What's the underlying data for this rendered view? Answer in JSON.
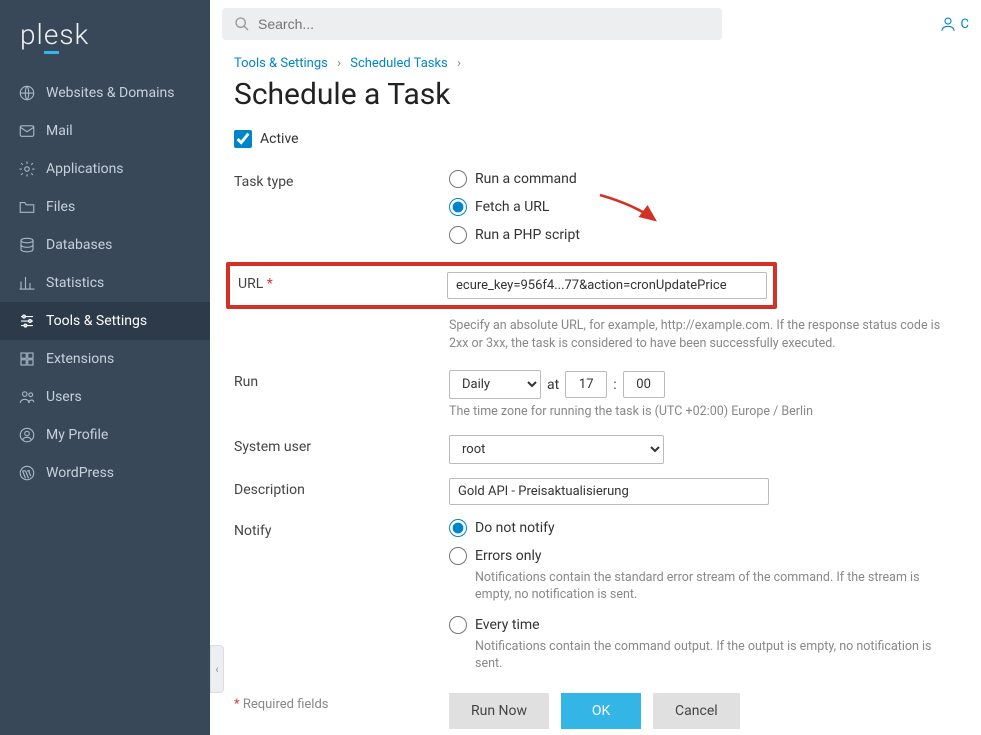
{
  "brand": "plesk",
  "sidebar": {
    "items": [
      {
        "label": "Websites & Domains",
        "icon": "globe"
      },
      {
        "label": "Mail",
        "icon": "mail"
      },
      {
        "label": "Applications",
        "icon": "gear"
      },
      {
        "label": "Files",
        "icon": "folder"
      },
      {
        "label": "Databases",
        "icon": "database"
      },
      {
        "label": "Statistics",
        "icon": "stats"
      },
      {
        "label": "Tools & Settings",
        "icon": "sliders"
      },
      {
        "label": "Extensions",
        "icon": "puzzle"
      },
      {
        "label": "Users",
        "icon": "users"
      },
      {
        "label": "My Profile",
        "icon": "profile"
      },
      {
        "label": "WordPress",
        "icon": "wordpress"
      }
    ],
    "activeIndex": 6
  },
  "search": {
    "placeholder": "Search..."
  },
  "userlink": "C",
  "breadcrumb": {
    "items": [
      "Tools & Settings",
      "Scheduled Tasks"
    ]
  },
  "page_title": "Schedule a Task",
  "form": {
    "active": {
      "label": "Active",
      "checked": true
    },
    "task_type": {
      "label": "Task type",
      "options": {
        "cmd": "Run a command",
        "url": "Fetch a URL",
        "php": "Run a PHP script"
      },
      "selected": "url"
    },
    "url": {
      "label": "URL",
      "required": true,
      "value": "ecure_key=956f4...77&action=cronUpdatePrice",
      "help": "Specify an absolute URL, for example, http://example.com. If the response status code is 2xx or 3xx, the task is considered to have been successfully executed."
    },
    "run": {
      "label": "Run",
      "freq": "Daily",
      "at_label": "at",
      "hour": "17",
      "minute": "00",
      "colon": ":",
      "help": "The time zone for running the task is (UTC +02:00) Europe / Berlin"
    },
    "system_user": {
      "label": "System user",
      "value": "root"
    },
    "description": {
      "label": "Description",
      "value": "Gold API - Preisaktualisierung"
    },
    "notify": {
      "label": "Notify",
      "options": {
        "none": "Do not notify",
        "errors": {
          "label": "Errors only",
          "help": "Notifications contain the standard error stream of the command. If the stream is empty, no notification is sent."
        },
        "always": {
          "label": "Every time",
          "help": "Notifications contain the command output. If the output is empty, no notification is sent."
        }
      },
      "selected": "none"
    },
    "required_note": "Required fields",
    "buttons": {
      "run_now": "Run Now",
      "ok": "OK",
      "cancel": "Cancel"
    }
  }
}
